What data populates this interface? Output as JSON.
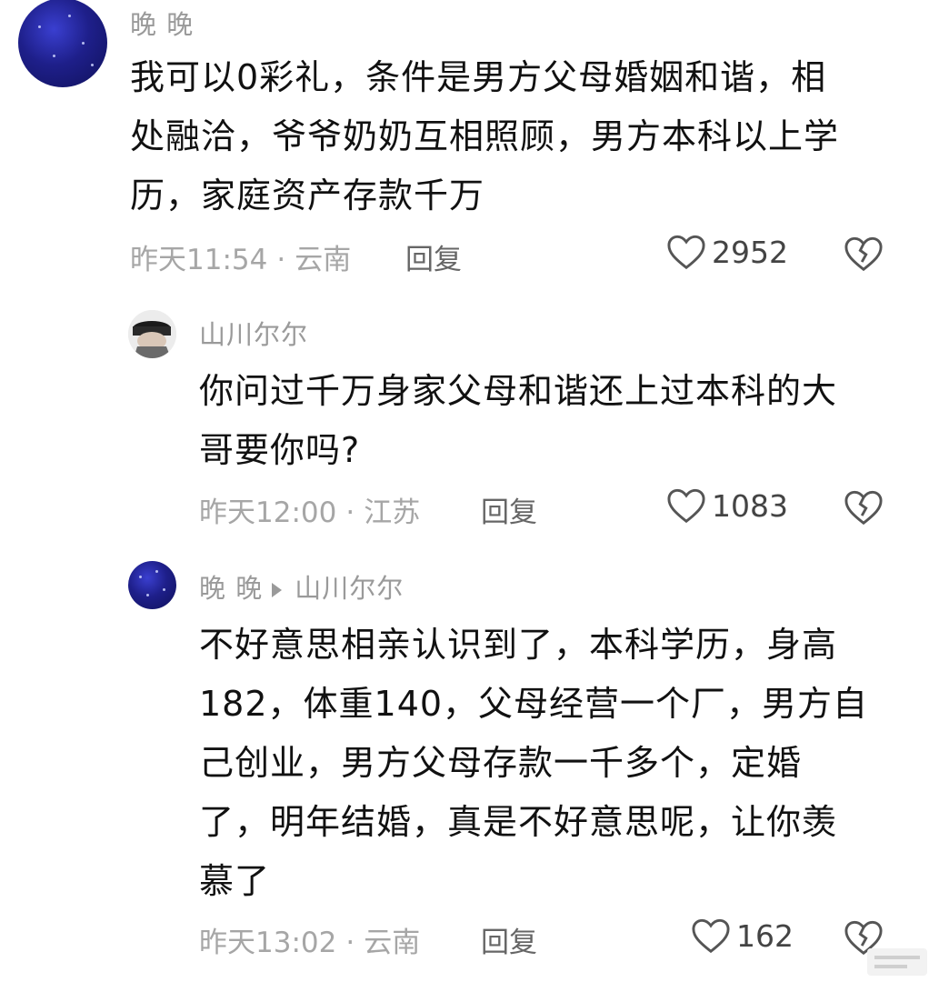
{
  "comments": [
    {
      "username": "晚 晚",
      "lines": [
        "我可以0彩礼，条件是男方父母婚姻和谐，相",
        "处融洽，爷爷奶奶互相照顾，男方本科以上学",
        "历，家庭资产存款千万"
      ],
      "time": "昨天11:54",
      "location": "云南",
      "reply_label": "回复",
      "likes": "2952"
    },
    {
      "username": "山川尔尔",
      "lines": [
        "你问过千万身家父母和谐还上过本科的大",
        "哥要你吗?"
      ],
      "time": "昨天12:00",
      "location": "江苏",
      "reply_label": "回复",
      "likes": "1083"
    },
    {
      "username": "晚 晚",
      "reply_to": "山川尔尔",
      "lines": [
        "不好意思相亲认识到了，本科学历，身高",
        "182，体重140，父母经营一个厂，男方自",
        "己创业，男方父母存款一千多个，定婚",
        "了，明年结婚，真是不好意思呢，让你羡",
        "慕了"
      ],
      "time": "昨天13:02",
      "location": "云南",
      "reply_label": "回复",
      "likes": "162"
    }
  ],
  "separator": "·",
  "icons": {
    "like": "heart-outline-icon",
    "dislike": "broken-heart-icon"
  },
  "colors": {
    "text": "#111111",
    "meta": "#a6a6a6",
    "username": "#9a9a9a"
  }
}
